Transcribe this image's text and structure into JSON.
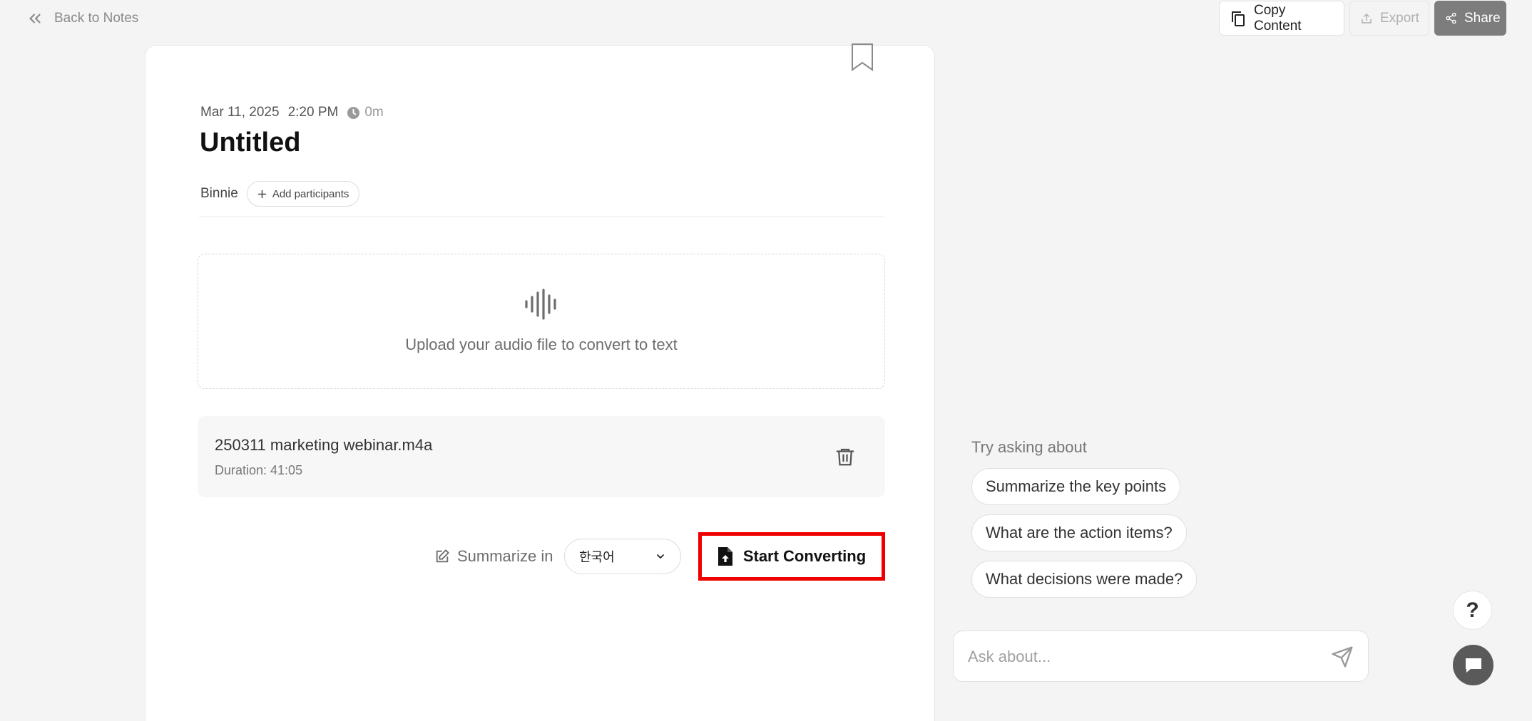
{
  "topbar": {
    "back_label": "Back to Notes",
    "copy_label": "Copy Content",
    "export_label": "Export",
    "share_label": "Share"
  },
  "note": {
    "date": "Mar 11, 2025",
    "time": "2:20 PM",
    "duration": "0m",
    "title": "Untitled",
    "participant": "Binnie",
    "add_participants_label": "Add participants"
  },
  "upload": {
    "prompt": "Upload your audio file to convert to text"
  },
  "file": {
    "name": "250311 marketing webinar.m4a",
    "duration": "Duration: 41:05"
  },
  "convert": {
    "summarize_label": "Summarize in",
    "language": "한국어",
    "start_label": "Start Converting"
  },
  "assistant": {
    "try_label": "Try asking about",
    "suggestions": [
      "Summarize the key points",
      "What are the action items?",
      "What decisions were made?"
    ],
    "ask_placeholder": "Ask about..."
  },
  "help": {
    "label": "?"
  },
  "colors": {
    "accent_dark": "#7d7d7d",
    "highlight": "#ef0000",
    "background": "#f4f4f4"
  },
  "icons": {
    "back": "double-chevron-left-icon",
    "copy": "copy-icon",
    "export": "upload-icon",
    "share": "share-icon",
    "bookmark": "bookmark-icon",
    "clock": "clock-icon",
    "plus": "plus-icon",
    "waveform": "waveform-icon",
    "trash": "trash-icon",
    "edit": "edit-icon",
    "chevron": "chevron-down-icon",
    "file_upload": "file-upload-icon",
    "send": "send-icon",
    "chat": "chat-icon"
  }
}
